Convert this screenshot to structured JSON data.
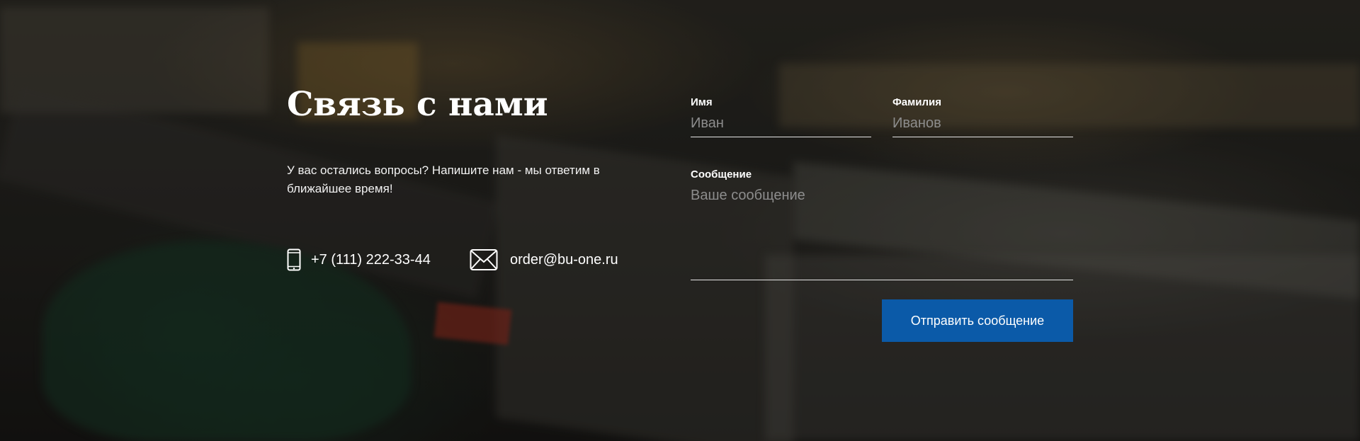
{
  "contact_section": {
    "title": "Связь с нами",
    "subtitle": "У вас остались вопросы? Напишите нам - мы ответим в ближайшее время!",
    "phone": {
      "icon": "phone-icon",
      "text": "+7 (111) 222-33-44"
    },
    "email": {
      "icon": "envelope-icon",
      "text": "order@bu-one.ru"
    }
  },
  "form": {
    "first_name": {
      "label": "Имя",
      "placeholder": "Иван",
      "value": ""
    },
    "last_name": {
      "label": "Фамилия",
      "placeholder": "Иванов",
      "value": ""
    },
    "message": {
      "label": "Сообщение",
      "placeholder": "Ваше сообщение",
      "value": ""
    },
    "submit_label": "Отправить сообщение"
  },
  "colors": {
    "accent": "#0b5aa8",
    "text": "#ffffff",
    "placeholder": "#8d8d8d",
    "underline": "#e6e6e6"
  }
}
